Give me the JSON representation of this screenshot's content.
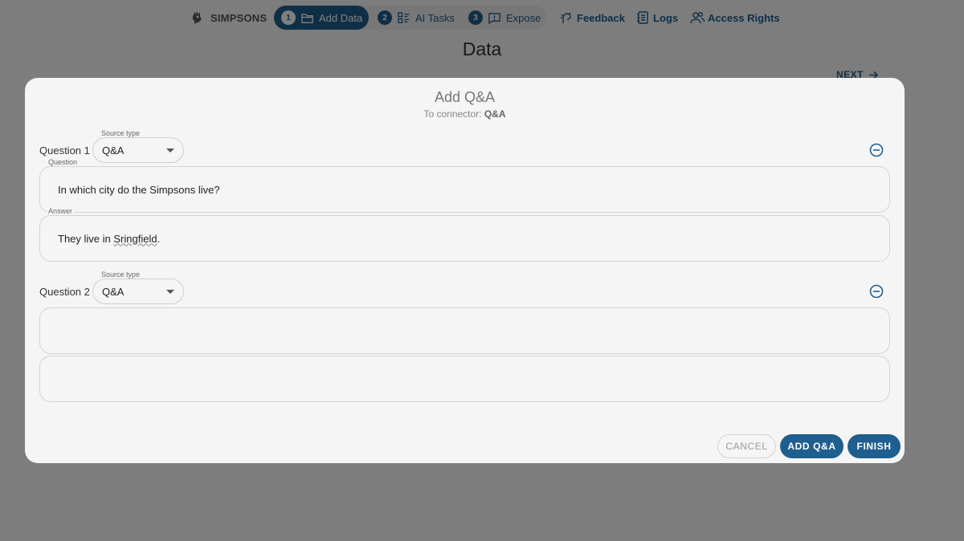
{
  "nav": {
    "brand": "SIMPSONS",
    "steps": [
      {
        "num": "1",
        "label": "Add Data",
        "icon": "folder-icon",
        "active": true
      },
      {
        "num": "2",
        "label": "AI Tasks",
        "icon": "tasks-icon",
        "active": false
      },
      {
        "num": "3",
        "label": "Expose",
        "icon": "chat-icon",
        "active": false
      }
    ],
    "links": [
      {
        "label": "Feedback",
        "icon": "feedback-icon"
      },
      {
        "label": "Logs",
        "icon": "notebook-icon"
      },
      {
        "label": "Access Rights",
        "icon": "users-icon"
      }
    ]
  },
  "page": {
    "title": "Data",
    "next_label": "NEXT"
  },
  "modal": {
    "title": "Add Q&A",
    "subtitle_prefix": "To connector: ",
    "connector_name": "Q&A",
    "source_type_label": "Source type",
    "question_field_label": "Question",
    "answer_field_label": "Answer",
    "questions": [
      {
        "label": "Question 1",
        "source_type": "Q&A",
        "question": "In which city do the Simpsons live?",
        "answer_pre": "They live in ",
        "answer_misspelled": "Sringfield",
        "answer_post": "."
      },
      {
        "label": "Question 2",
        "source_type": "Q&A",
        "question": "",
        "answer": ""
      }
    ],
    "buttons": {
      "cancel": "CANCEL",
      "add": "ADD Q&A",
      "finish": "FINISH"
    }
  },
  "colors": {
    "accent": "#1f5f8f",
    "modal_bg": "#f5f5f5",
    "overlay": "rgba(0,0,0,0.5)"
  }
}
